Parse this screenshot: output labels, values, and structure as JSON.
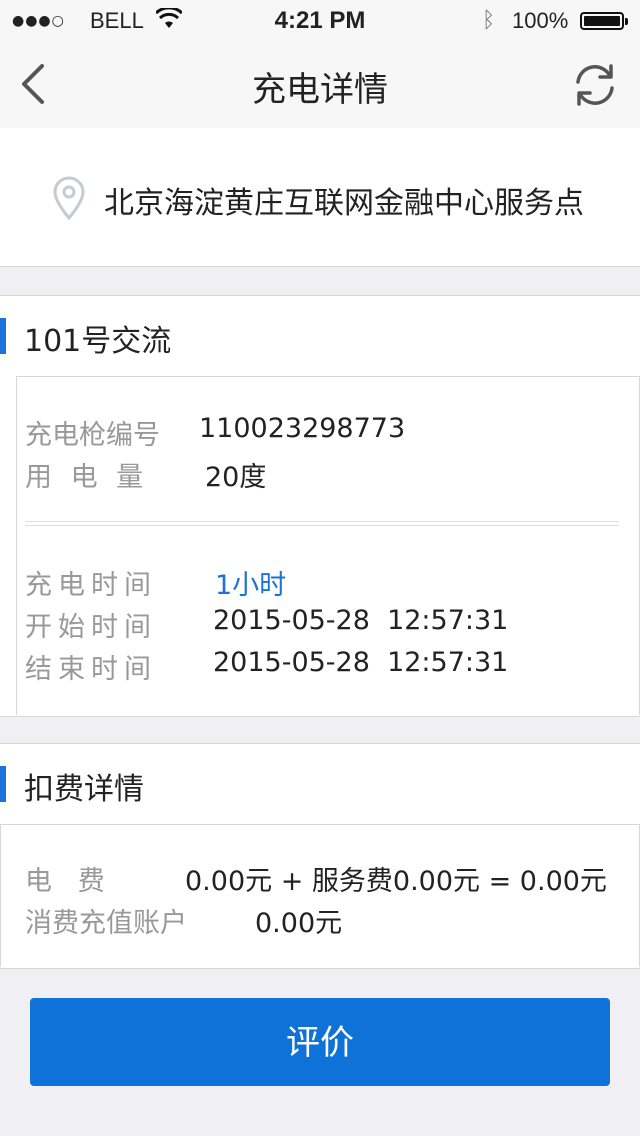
{
  "status_bar": {
    "signal": "●●●○",
    "carrier": "BELL",
    "time": "4:21 PM",
    "battery": "100%"
  },
  "nav": {
    "title": "充电详情"
  },
  "location": {
    "name": "北京海淀黄庄互联网金融中心服务点"
  },
  "charge_section": {
    "title": "101号交流",
    "gun_label": "充电枪编号",
    "gun_value": "110023298773",
    "power_label": "用 电 量",
    "power_value": "20度",
    "duration_label": "充电时间",
    "duration_value": "1小时",
    "start_label": "开始时间",
    "start_value": "2015-05-28  12:57:31",
    "end_label": "结束时间",
    "end_value": "2015-05-28  12:57:31"
  },
  "fee_section": {
    "title": "扣费详情",
    "fee_label": "电   费",
    "fee_value": "0.00元 + 服务费0.00元 = 0.00元",
    "account_label": "消费充值账户",
    "account_value": "0.00元"
  },
  "actions": {
    "rate_label": "评价"
  },
  "colors": {
    "accent": "#1a73d8",
    "button": "#0f72d9",
    "background": "#efeff4"
  }
}
